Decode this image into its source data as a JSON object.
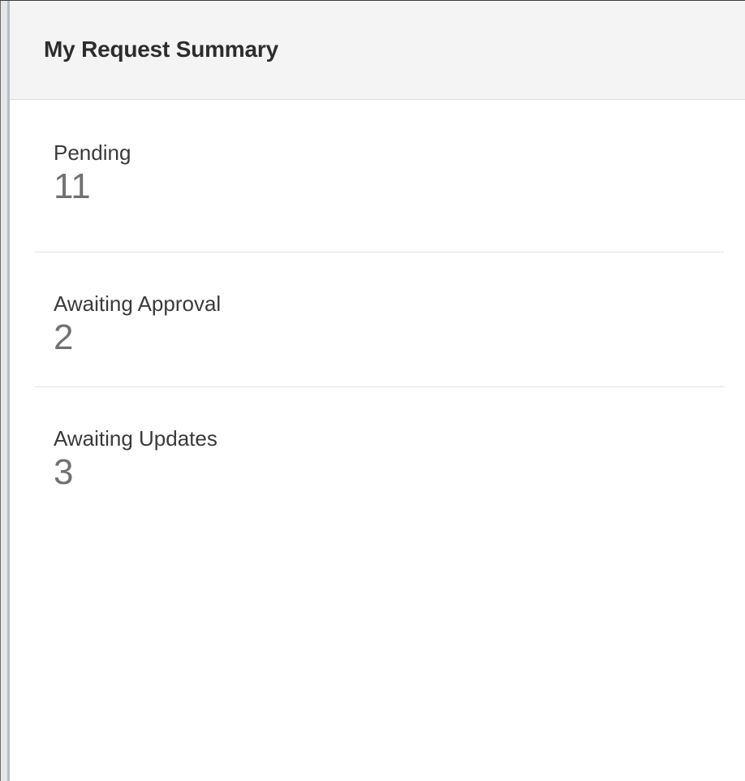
{
  "panel": {
    "title": "My Request Summary"
  },
  "summary": {
    "items": [
      {
        "label": "Pending",
        "value": "11"
      },
      {
        "label": "Awaiting Approval",
        "value": "2"
      },
      {
        "label": "Awaiting Updates",
        "value": "3"
      }
    ]
  },
  "colors": {
    "header_bg": "#f4f4f4",
    "title_text": "#2d2d2d",
    "label_text": "#3a3a3a",
    "value_text": "#717171",
    "divider": "#e2e2e2",
    "rail_accent": "#b9bcc8"
  }
}
